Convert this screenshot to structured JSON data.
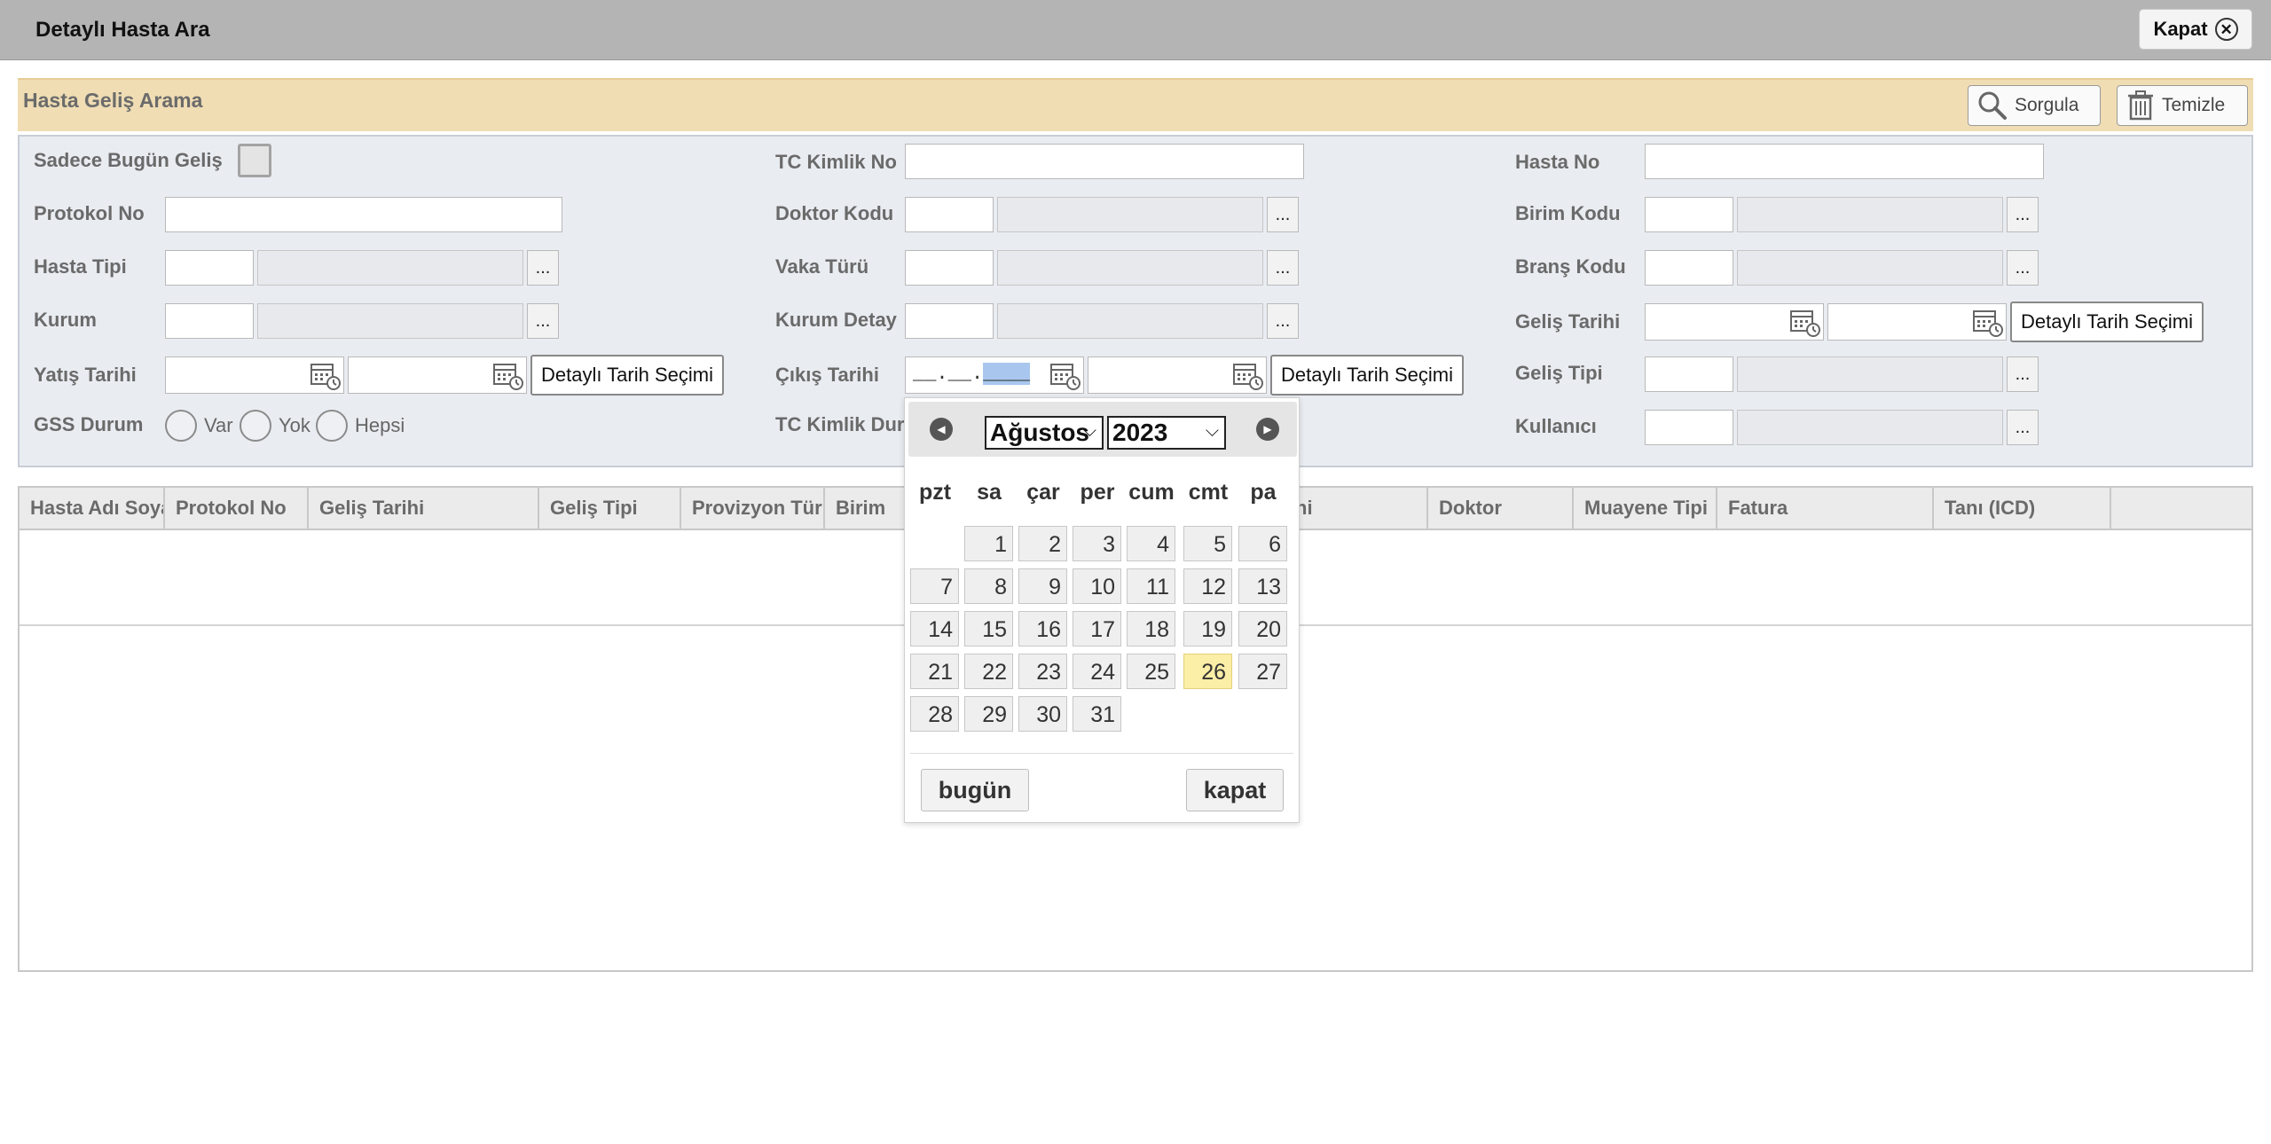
{
  "dialog": {
    "title": "Detaylı Hasta Ara",
    "close_label": "Kapat"
  },
  "search": {
    "title": "Hasta Geliş Arama",
    "query_button": "Sorgula",
    "clear_button": "Temizle"
  },
  "form": {
    "only_today_label": "Sadece Bugün Geliş",
    "tc_no_label": "TC Kimlik No",
    "patient_no_label": "Hasta No",
    "protocol_no_label": "Protokol No",
    "doctor_code_label": "Doktor Kodu",
    "unit_code_label": "Birim Kodu",
    "patient_type_label": "Hasta Tipi",
    "case_type_label": "Vaka Türü",
    "branch_code_label": "Branş Kodu",
    "institution_label": "Kurum",
    "institution_detail_label": "Kurum Detay",
    "arrival_date_label": "Geliş Tarihi",
    "admission_date_label": "Yatış Tarihi",
    "discharge_date_label": "Çıkış Tarihi",
    "arrival_type_label": "Geliş Tipi",
    "gss_status_label": "GSS Durum",
    "tc_status_label": "TC Kimlik Dur",
    "user_label": "Kullanıcı",
    "detail_date_button": "Detaylı Tarih Seçimi",
    "more_button": "...",
    "discharge_date_mask_a": "__.__.",
    "discharge_date_mask_b": "____",
    "gss_options": [
      "Var",
      "Yok",
      "Hepsi"
    ]
  },
  "table": {
    "columns": [
      "Hasta Adı Soyadı",
      "Protokol No",
      "Geliş Tarihi",
      "Geliş Tipi",
      "Provizyon Türü",
      "Birim",
      "ni",
      "Doktor",
      "Muayene Tipi",
      "Fatura",
      "Tanı (ICD)",
      ""
    ]
  },
  "calendar": {
    "month": "Ağustos",
    "year": "2023",
    "weekdays": [
      "pzt",
      "sa",
      "çar",
      "per",
      "cum",
      "cmt",
      "pa"
    ],
    "today_day": "26",
    "days": [
      "1",
      "2",
      "3",
      "4",
      "5",
      "6",
      "7",
      "8",
      "9",
      "10",
      "11",
      "12",
      "13",
      "14",
      "15",
      "16",
      "17",
      "18",
      "19",
      "20",
      "21",
      "22",
      "23",
      "24",
      "25",
      "26",
      "27",
      "28",
      "29",
      "30",
      "31"
    ],
    "today_button": "bugün",
    "close_button": "kapat"
  },
  "colors": {
    "header_band": "#f0ddb4",
    "form_panel": "#e9ecf1",
    "today_highlight": "#fbeea6"
  }
}
